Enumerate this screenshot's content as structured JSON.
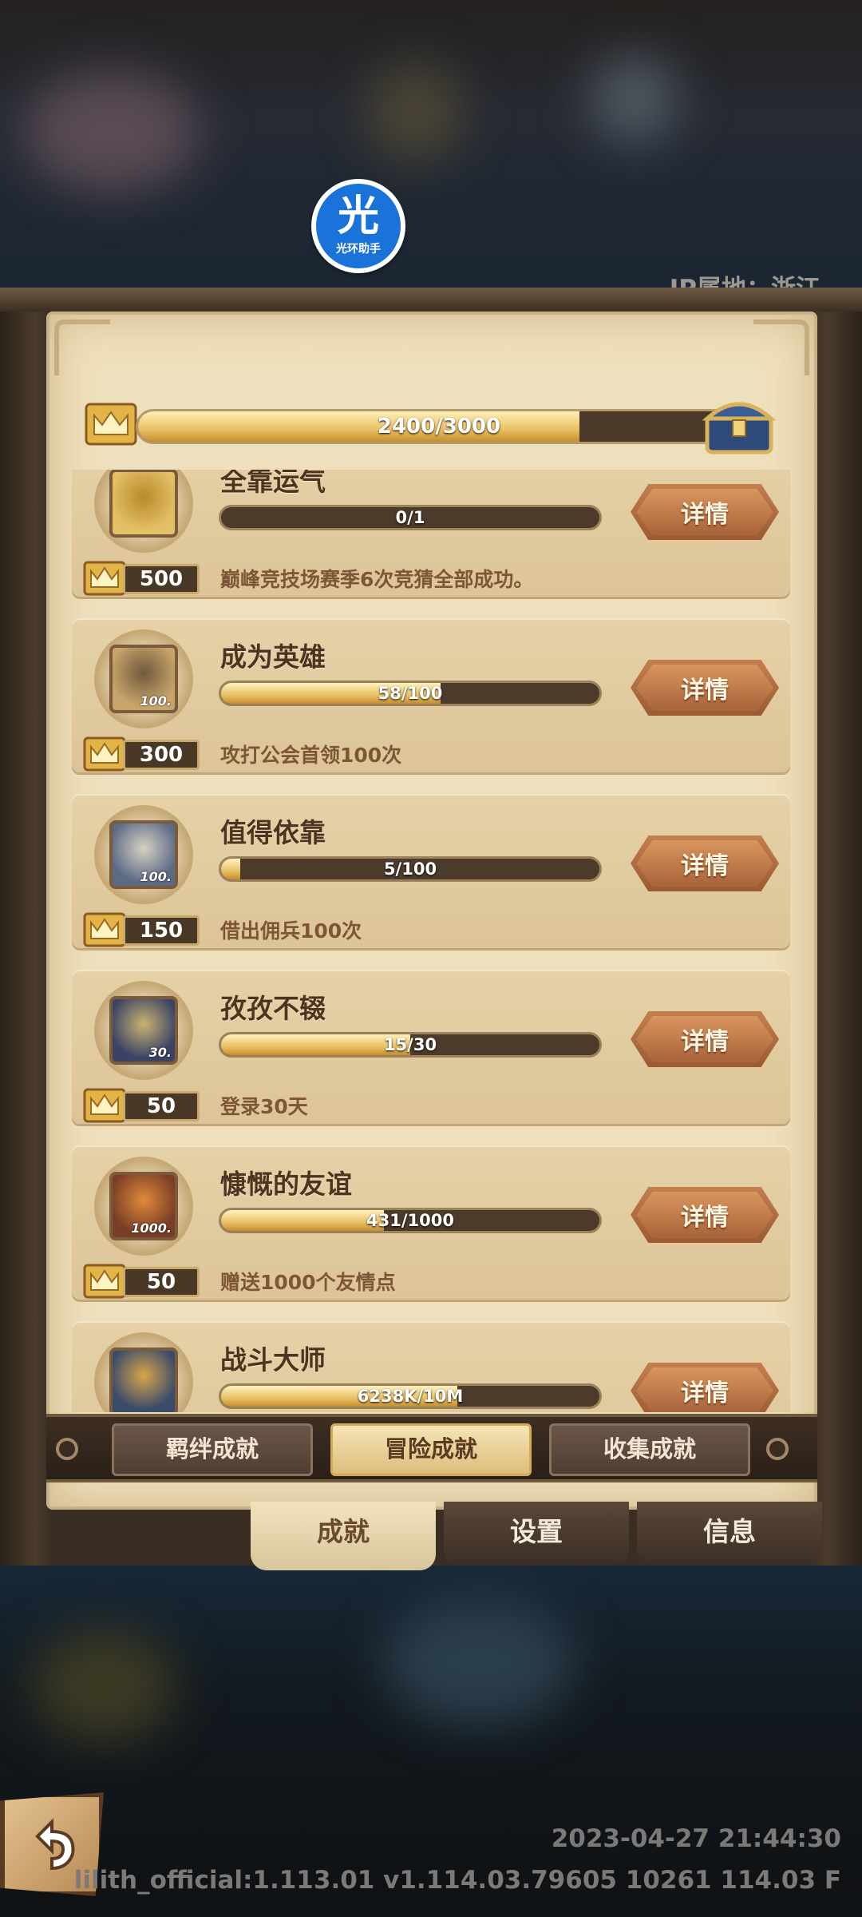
{
  "watermark": {
    "glyph": "光",
    "text": "光环助手"
  },
  "ip_location": "IP属地：浙江",
  "total_progress": {
    "current": 2400,
    "max": 3000,
    "text": "2400/3000",
    "fraction": 0.8
  },
  "achievements": [
    {
      "title": "全靠运气",
      "progress_text": "0/1",
      "fraction": 0.0,
      "points": "500",
      "desc": "巅峰竞技场赛季6次竞猜全部成功。",
      "button": "详情",
      "art": "coins-icon",
      "art_num": ""
    },
    {
      "title": "成为英雄",
      "progress_text": "58/100",
      "fraction": 0.58,
      "points": "300",
      "desc": "攻打公会首领100次",
      "button": "详情",
      "art": "hero-art-icon",
      "art_num": "100."
    },
    {
      "title": "值得依靠",
      "progress_text": "5/100",
      "fraction": 0.05,
      "points": "150",
      "desc": "借出佣兵100次",
      "button": "详情",
      "art": "contract-art-icon",
      "art_num": "100."
    },
    {
      "title": "孜孜不辍",
      "progress_text": "15/30",
      "fraction": 0.5,
      "points": "50",
      "desc": "登录30天",
      "button": "详情",
      "art": "moon-art-icon",
      "art_num": "30."
    },
    {
      "title": "慷慨的友谊",
      "progress_text": "431/1000",
      "fraction": 0.431,
      "points": "50",
      "desc": "赠送1000个友情点",
      "button": "详情",
      "art": "lantern-art-icon",
      "art_num": "1000."
    },
    {
      "title": "战斗大师",
      "progress_text": "6238K/10M",
      "fraction": 0.6238,
      "points": "",
      "desc": "",
      "button": "详情",
      "art": "battle-art-icon",
      "art_num": ""
    }
  ],
  "sub_tabs": [
    {
      "label": "羁绊成就",
      "active": false
    },
    {
      "label": "冒险成就",
      "active": true
    },
    {
      "label": "收集成就",
      "active": false
    }
  ],
  "main_tabs": [
    {
      "label": "成就",
      "active": true
    },
    {
      "label": "设置",
      "active": false
    },
    {
      "label": "信息",
      "active": false
    }
  ],
  "footer": {
    "datetime": "2023-04-27 21:44:30",
    "version": "lilith_official:1.113.01  v1.114.03.79605 10261 114.03 F"
  },
  "colors": {
    "accent_gold": "#e8bf63",
    "parchment": "#efe0bd",
    "button_brown": "#a8643a"
  }
}
